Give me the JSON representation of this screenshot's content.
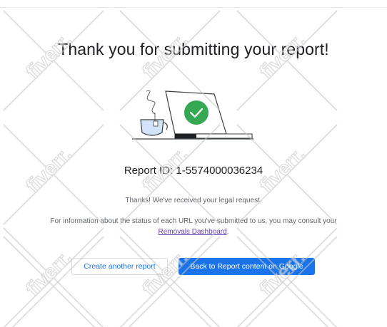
{
  "title": "Thank you for submitting your report!",
  "report_id": "Report ID: 1-5574000036234",
  "message": "Thanks! We've received your legal request.",
  "info": {
    "text": "For information about the status of each URL you've submitted to us, you may consult your",
    "link": "Removals Dashboard",
    "suffix": "."
  },
  "buttons": {
    "create_another": "Create another report",
    "back": "Back to Report content on Google"
  },
  "illustration": {
    "icons": [
      "tea-cup-icon",
      "laptop-icon",
      "check-circle-icon"
    ],
    "accent": "#34a853"
  },
  "watermark": {
    "text": "fiverr.",
    "tiles": [
      {
        "col": 0,
        "row": 0
      },
      {
        "col": 1,
        "row": 0
      },
      {
        "col": 2,
        "row": 0
      },
      {
        "col": 0,
        "row": 1
      },
      {
        "col": 1,
        "row": 1
      },
      {
        "col": 2,
        "row": 1
      },
      {
        "col": 0,
        "row": 2
      },
      {
        "col": 1,
        "row": 2
      },
      {
        "col": 2,
        "row": 2
      },
      {
        "col": 0,
        "row": 3
      },
      {
        "col": 1,
        "row": 3
      },
      {
        "col": 2,
        "row": 3
      }
    ]
  },
  "colors": {
    "primary": "#1a73e8",
    "link": "#6a3fb0",
    "check": "#34a853"
  }
}
